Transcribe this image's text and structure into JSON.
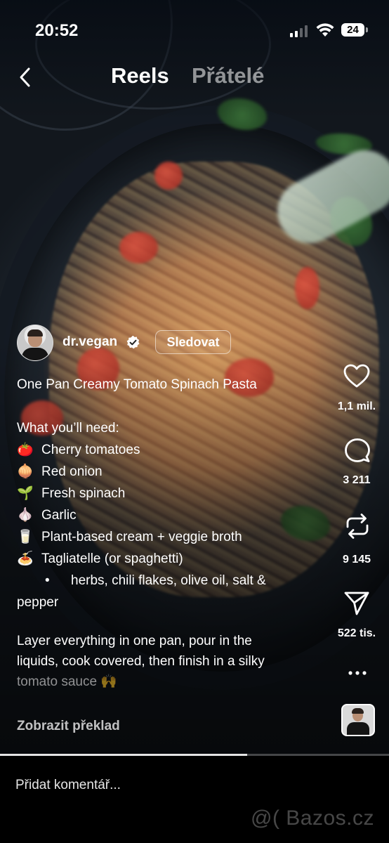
{
  "status_bar": {
    "time": "20:52",
    "battery": "24"
  },
  "header": {
    "back_icon": "chevron-left-icon",
    "tabs": [
      {
        "label": "Reels",
        "active": true
      },
      {
        "label": "Přátelé",
        "active": false
      }
    ]
  },
  "post": {
    "username": "dr.vegan",
    "follow_label": "Sledovat",
    "title": "One Pan Creamy Tomato Spinach Pasta",
    "list_heading": "What you’ll need:",
    "ingredients": [
      {
        "emoji": "🍅",
        "text": "Cherry tomatoes"
      },
      {
        "emoji": "🧅",
        "text": "Red onion"
      },
      {
        "emoji": "🌱",
        "text": "Fresh spinach"
      },
      {
        "emoji": "🧄",
        "text": "Garlic"
      },
      {
        "emoji": "🥛",
        "text": "Plant-based cream + veggie broth"
      },
      {
        "emoji": "🍝",
        "text": "Tagliatelle (or spaghetti)"
      }
    ],
    "extras_bullet": "•",
    "extras_line1": "herbs, chili flakes, olive oil, salt &",
    "extras_line2": "pepper",
    "body_line1": "Layer everything in one pan, pour in the",
    "body_line2": "liquids, cook covered, then finish in a silky",
    "body_line3": "tomato sauce 🙌",
    "translate_label": "Zobrazit překlad"
  },
  "actions": {
    "likes": "1,1 mil.",
    "comments": "3 211",
    "reposts": "9 145",
    "shares": "522 tis."
  },
  "progress": 0.635,
  "comment_placeholder": "Přidat komentář...",
  "watermark": "@( Bazos.cz"
}
